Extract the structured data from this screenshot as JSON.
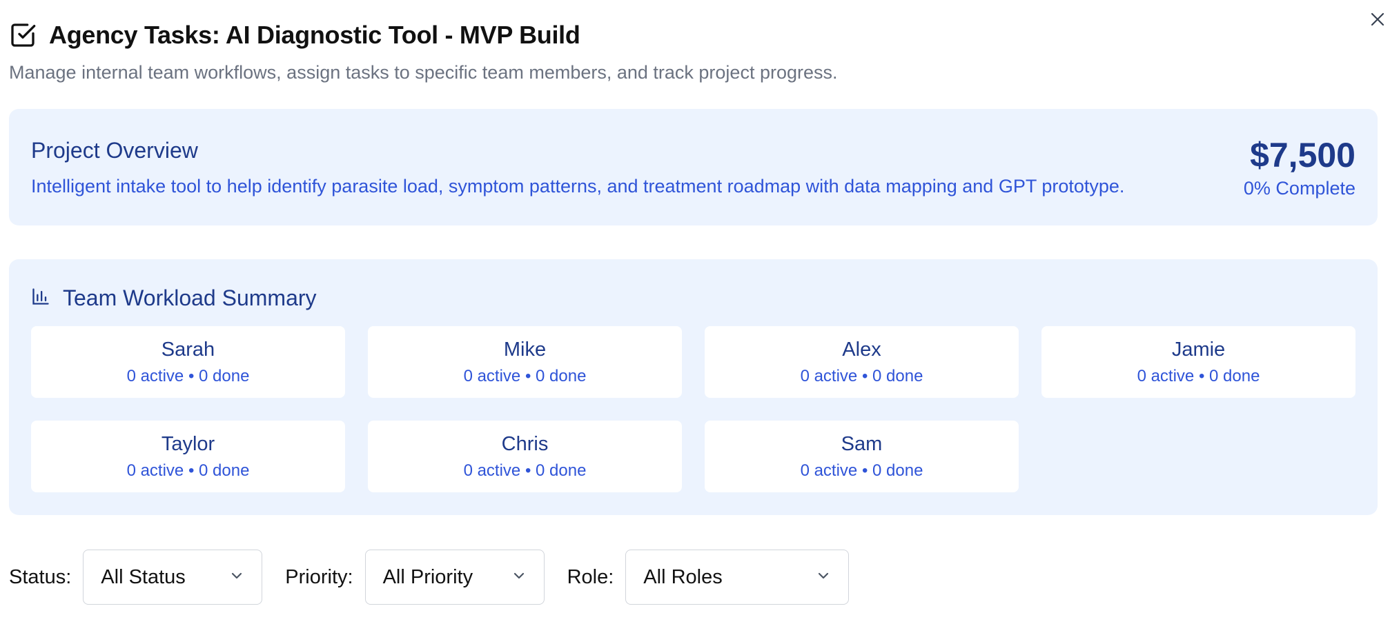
{
  "header": {
    "title": "Agency Tasks: AI Diagnostic Tool - MVP Build",
    "subtitle": "Manage internal team workflows, assign tasks to specific team members, and track project progress.",
    "icons": {
      "title": "checkbox-square-icon",
      "close": "close-icon"
    }
  },
  "overview": {
    "title": "Project Overview",
    "description": "Intelligent intake tool to help identify parasite load, symptom patterns, and treatment roadmap with data mapping and GPT prototype.",
    "amount": "$7,500",
    "completion": "0% Complete"
  },
  "workload": {
    "title": "Team Workload Summary",
    "icon": "bar-chart-icon",
    "members": [
      {
        "name": "Sarah",
        "stats": "0 active • 0 done"
      },
      {
        "name": "Mike",
        "stats": "0 active • 0 done"
      },
      {
        "name": "Alex",
        "stats": "0 active • 0 done"
      },
      {
        "name": "Jamie",
        "stats": "0 active • 0 done"
      },
      {
        "name": "Taylor",
        "stats": "0 active • 0 done"
      },
      {
        "name": "Chris",
        "stats": "0 active • 0 done"
      },
      {
        "name": "Sam",
        "stats": "0 active • 0 done"
      }
    ]
  },
  "filters": {
    "status": {
      "label": "Status:",
      "value": "All Status"
    },
    "priority": {
      "label": "Priority:",
      "value": "All Priority"
    },
    "role": {
      "label": "Role:",
      "value": "All Roles"
    }
  },
  "colors": {
    "panel_bg": "#ecf3fe",
    "heading_blue": "#1e3a8a",
    "text_blue": "#2f54d8",
    "muted_gray": "#6b7280"
  }
}
